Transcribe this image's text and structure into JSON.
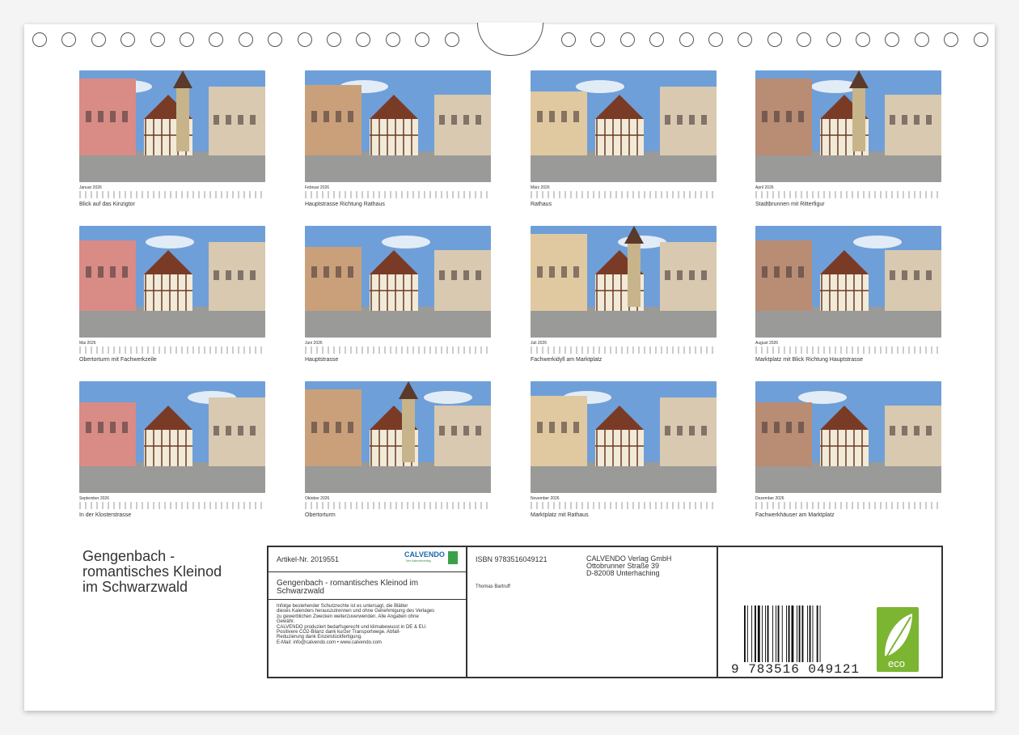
{
  "months": [
    {
      "label": "Januar 2026",
      "caption": "Blick auf das Kinzigtor"
    },
    {
      "label": "Februar 2026",
      "caption": "Hauptstrasse Richtung Rathaus"
    },
    {
      "label": "März 2026",
      "caption": "Rathaus"
    },
    {
      "label": "April 2026",
      "caption": "Stadtbrunnen mit Ritterfigur"
    },
    {
      "label": "Mai 2026",
      "caption": "Obertorturm mit Fachwerkzeile"
    },
    {
      "label": "Juni 2026",
      "caption": "Hauptstrasse"
    },
    {
      "label": "Juli 2026",
      "caption": "Fachwerkidyll am Marktplatz"
    },
    {
      "label": "August 2026",
      "caption": "Marktplatz mit Blick Richtung Hauptstrasse"
    },
    {
      "label": "September 2026",
      "caption": "In der Klosterstrasse"
    },
    {
      "label": "Oktober 2026",
      "caption": "Obertorturm"
    },
    {
      "label": "November 2026",
      "caption": "Marktplatz mit Rathaus"
    },
    {
      "label": "Dezember 2026",
      "caption": "Fachwerkhäuser am Marktplatz"
    }
  ],
  "cover_title": {
    "line1": "Gengenbach -",
    "line2": "romantisches Kleinod",
    "line3": "im Schwarzwald"
  },
  "info": {
    "article": "Artikel-Nr. 2019551",
    "logo": "CALVENDO",
    "logo_sub": "Ihre Kalenderverlag",
    "title": "Gengenbach - romantisches Kleinod im Schwarzwald",
    "legal": [
      "Infolge bestehender Schutzrechte ist es untersagt, die Blätter",
      "dieses Kalenders herauszutrennen und ohne Genehmigung des Verlages",
      "zu gewerblichen Zwecken weiterzuverwenden. Alle Angaben ohne",
      "Gewähr.",
      "CALVENDO produziert bedarfsgerecht und klimabewusst in DE & EU.",
      "Positivere CO2-Bilanz dank kurzer Transportwege. Abfall-",
      "Reduzierung dank Einzelstückfertigung.",
      "E-Mail: info@calvendo.com • www.calvendo.com"
    ],
    "isbn": "ISBN 9783516049121",
    "author": "Thomas Bartruff",
    "publisher": [
      "CALVENDO Verlag GmbH",
      "Ottobrunner Straße 39",
      "D-82008 Unterhaching"
    ],
    "barcode_number": "9 783516 049121",
    "eco_label": "eco"
  },
  "colors": {
    "sky": "#6f9fd8",
    "facade_pink": "#d98b86",
    "timber": "#6b3b24",
    "eco_green": "#7cb531"
  }
}
